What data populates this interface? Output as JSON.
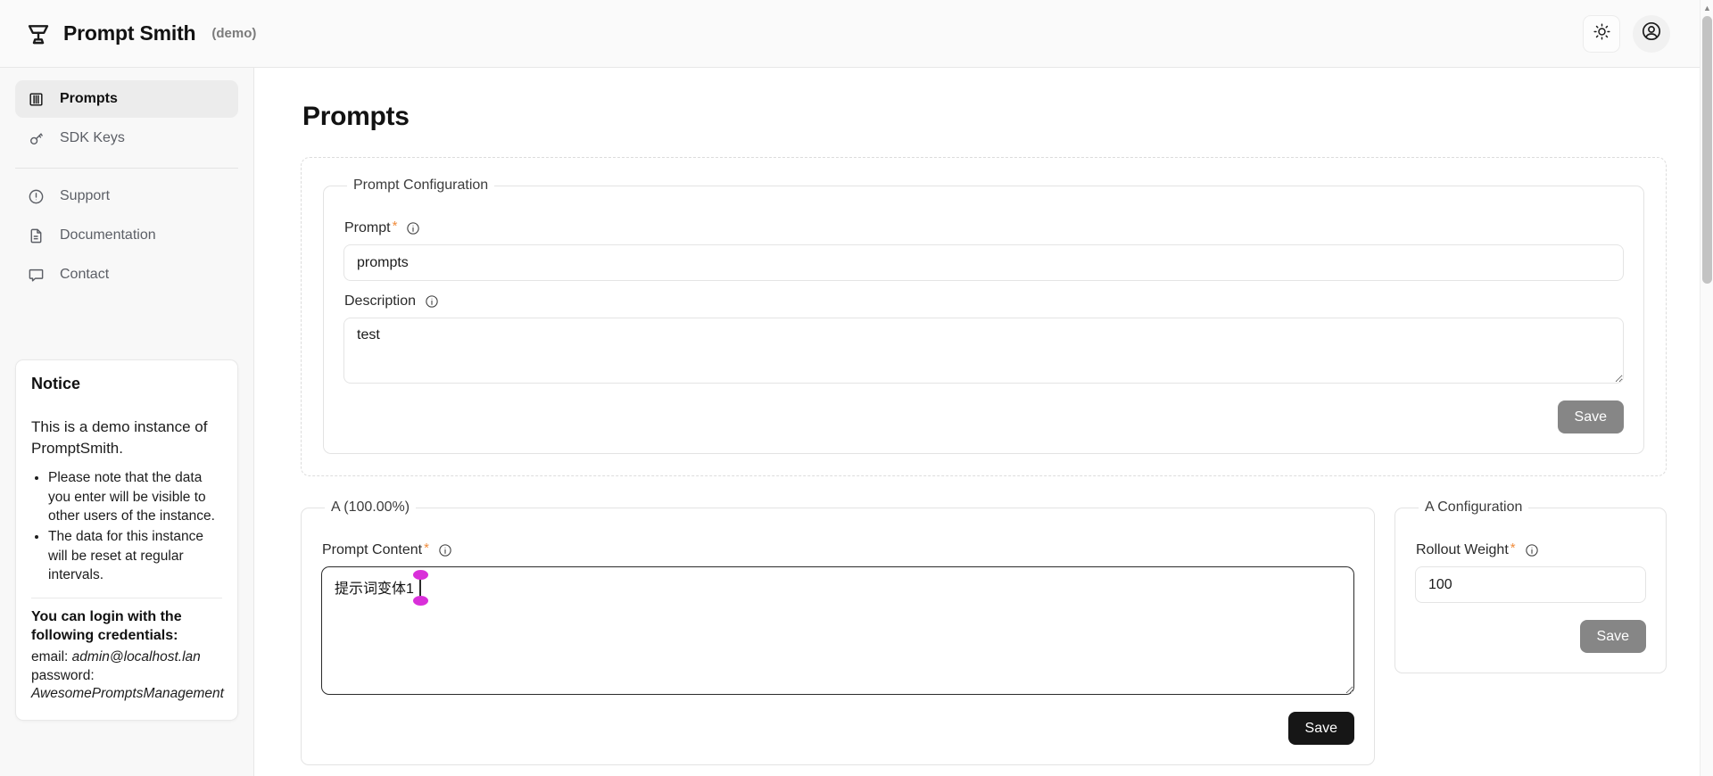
{
  "header": {
    "brand_title": "Prompt Smith",
    "brand_demo": "(demo)",
    "brand_icon": "anvil-icon",
    "theme_toggle_icon": "sun-icon",
    "account_icon": "user-circle-icon"
  },
  "sidebar": {
    "items": [
      {
        "label": "Prompts",
        "icon": "book-icon",
        "active": true
      },
      {
        "label": "SDK Keys",
        "icon": "key-icon",
        "active": false
      },
      {
        "label": "Support",
        "icon": "alert-circle-icon",
        "active": false
      },
      {
        "label": "Documentation",
        "icon": "file-text-icon",
        "active": false
      },
      {
        "label": "Contact",
        "icon": "message-square-icon",
        "active": false
      }
    ],
    "notice": {
      "title": "Notice",
      "lead": "This is a demo instance of PromptSmith.",
      "bullets": [
        "Please note that the data you enter will be visible to other users of the instance.",
        "The data for this instance will be reset at regular intervals."
      ],
      "credentials_heading": "You can login with the following credentials:",
      "email_label": "email:",
      "email_value": "admin@localhost.lan",
      "password_label": "password:",
      "password_value": "AwesomePromptsManagement"
    }
  },
  "main": {
    "page_title": "Prompts",
    "prompt_config": {
      "legend": "Prompt Configuration",
      "prompt_label": "Prompt",
      "prompt_required": "*",
      "prompt_value": "prompts",
      "description_label": "Description",
      "description_value": "test",
      "save_label": "Save"
    },
    "variant": {
      "legend": "A (100.00%)",
      "content_label": "Prompt Content",
      "content_required": "*",
      "content_value": "提示词变体1",
      "save_label": "Save"
    },
    "variant_config": {
      "legend": "A Configuration",
      "weight_label": "Rollout Weight",
      "weight_required": "*",
      "weight_value": "100",
      "save_label": "Save"
    }
  },
  "scrollbar": {
    "up_arrow_icon": "chevron-up-icon"
  },
  "colors": {
    "accent_required": "#f08c3c",
    "selection_handle": "#d92fd9",
    "button_disabled": "#868686",
    "button_primary": "#161616"
  }
}
